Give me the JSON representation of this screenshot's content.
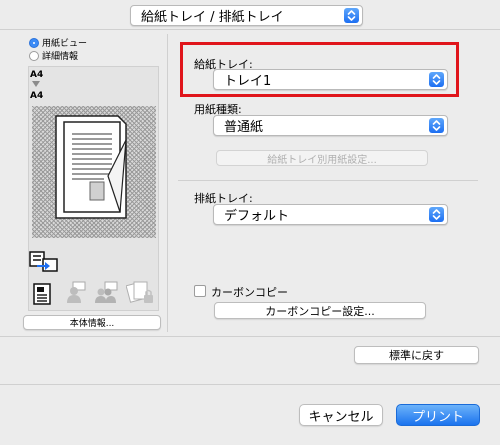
{
  "header": {
    "dropdown_label": "給紙トレイ / 排紙トレイ"
  },
  "view_mode": {
    "options": [
      "用紙ビュー",
      "詳細情報"
    ],
    "selected": 0
  },
  "preview": {
    "paper_size_top": "A4",
    "paper_size_bottom": "A4",
    "device_info_button": "本体情報..."
  },
  "paper_tray": {
    "label": "給紙トレイ:",
    "value": "トレイ1"
  },
  "paper_type": {
    "label": "用紙種類:",
    "value": "普通紙"
  },
  "tray_paper_settings_button": "給紙トレイ別用紙設定...",
  "output_tray": {
    "label": "排紙トレイ:",
    "value": "デフォルト"
  },
  "carbon_copy": {
    "checkbox_label": "カーボンコピー",
    "checked": false,
    "settings_button": "カーボンコピー設定..."
  },
  "restore_defaults_button": "標準に戻す",
  "footer": {
    "cancel_button": "キャンセル",
    "print_button": "プリント"
  },
  "colors": {
    "accent": "#1d6ff2",
    "highlight_border": "#e0151b"
  }
}
